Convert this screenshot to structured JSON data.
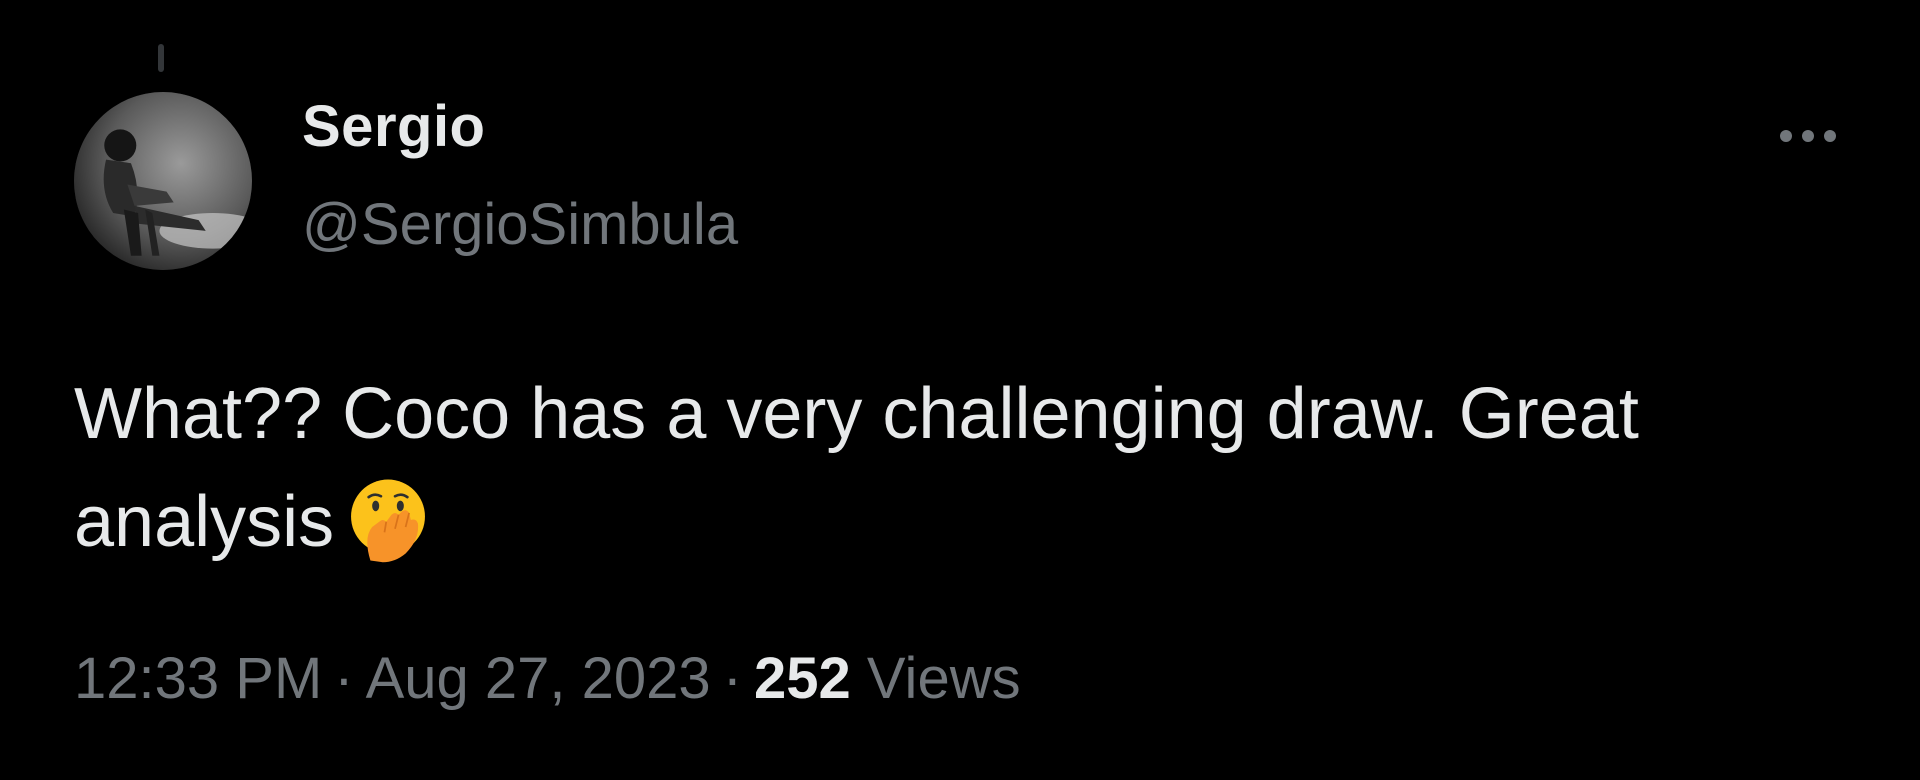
{
  "author": {
    "display_name": "Sergio",
    "handle": "@SergioSimbula"
  },
  "tweet": {
    "text": "What?? Coco has a very challenging draw. Great analysis",
    "emoji": "face-with-hand-over-mouth"
  },
  "meta": {
    "time": "12:33 PM",
    "separator": "·",
    "date": "Aug 27, 2023",
    "views_count": "252",
    "views_label": "Views"
  },
  "icons": {
    "more": "more-horizontal-icon"
  },
  "colors": {
    "background": "#000000",
    "primary_text": "#e7e9ea",
    "secondary_text": "#71767b",
    "thread_line": "#333639"
  }
}
